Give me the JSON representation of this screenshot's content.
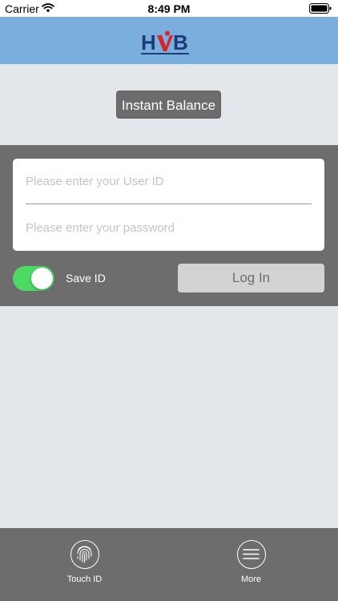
{
  "status_bar": {
    "carrier": "Carrier",
    "time": "8:49 PM",
    "wifi_icon": "wifi-icon",
    "battery_icon": "battery-icon"
  },
  "header": {
    "logo_text": "HVB",
    "logo_colors": {
      "navy": "#1f3a7a",
      "red": "#d9242b"
    },
    "background": "#7aaedc"
  },
  "instant_balance": {
    "label": "Instant Balance"
  },
  "login": {
    "user_id": {
      "value": "",
      "placeholder": "Please enter your User ID"
    },
    "password": {
      "value": "",
      "placeholder": "Please enter your password"
    },
    "save_id": {
      "label": "Save ID",
      "on": true,
      "color": "#4cd964"
    },
    "login_button": "Log In"
  },
  "tab_bar": {
    "items": [
      {
        "label": "Touch ID",
        "icon": "fingerprint-icon"
      },
      {
        "label": "More",
        "icon": "menu-icon"
      }
    ]
  }
}
